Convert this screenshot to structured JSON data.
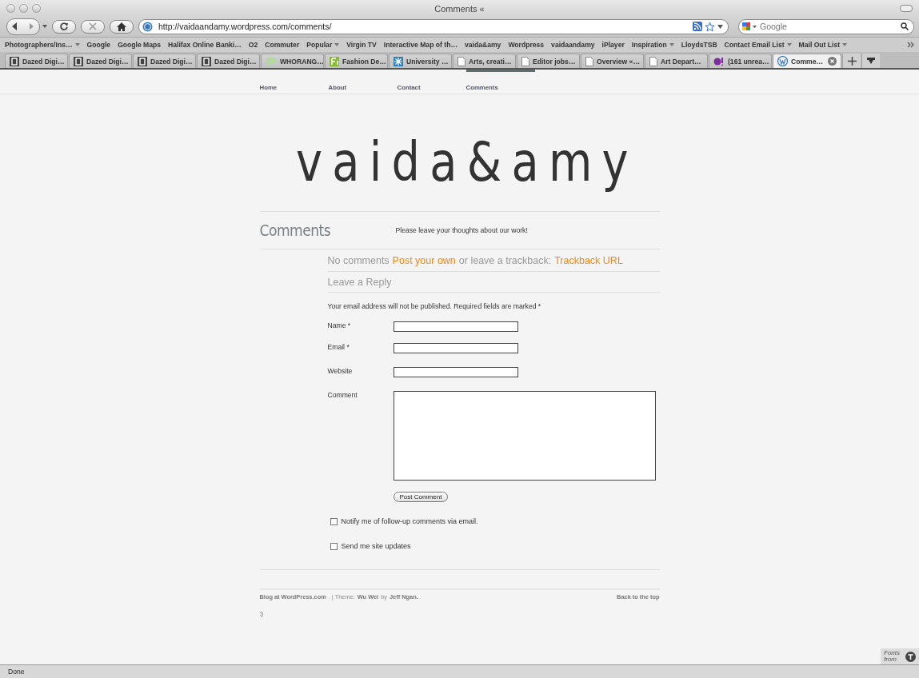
{
  "window": {
    "title": "Comments «"
  },
  "toolbar": {
    "url": "http://vaidaandamy.wordpress.com/comments/",
    "search_placeholder": "Google"
  },
  "bookmarks": [
    {
      "label": "Photographers/Ins…",
      "menu": true
    },
    {
      "label": "Google",
      "menu": false
    },
    {
      "label": "Google Maps",
      "menu": false
    },
    {
      "label": "Halifax Online Banki…",
      "menu": false
    },
    {
      "label": "O2",
      "menu": false
    },
    {
      "label": "Commuter",
      "menu": false
    },
    {
      "label": "Popular",
      "menu": true
    },
    {
      "label": "Virgin TV",
      "menu": false
    },
    {
      "label": "Interactive Map of th…",
      "menu": false
    },
    {
      "label": "vaida&amy",
      "menu": false
    },
    {
      "label": "Wordpress",
      "menu": false
    },
    {
      "label": "vaidaandamy",
      "menu": false
    },
    {
      "label": "iPlayer",
      "menu": false
    },
    {
      "label": "Inspiration",
      "menu": true
    },
    {
      "label": "LloydsTSB",
      "menu": false
    },
    {
      "label": "Contact Email List",
      "menu": true
    },
    {
      "label": "Mail Out List",
      "menu": true
    }
  ],
  "tabs": [
    {
      "label": "Dazed Digi…",
      "kind": "d",
      "selected": false
    },
    {
      "label": "Dazed Digi…",
      "kind": "d",
      "selected": false
    },
    {
      "label": "Dazed Digi…",
      "kind": "d",
      "selected": false
    },
    {
      "label": "Dazed Digi…",
      "kind": "d",
      "selected": false
    },
    {
      "label": "WHORANG…",
      "kind": "bubble",
      "selected": false
    },
    {
      "label": "Fashion De…",
      "kind": "fi",
      "selected": false
    },
    {
      "label": "University …",
      "kind": "star",
      "selected": false
    },
    {
      "label": "Arts, creati…",
      "kind": "page",
      "selected": false
    },
    {
      "label": "Editor jobs…",
      "kind": "page",
      "selected": false
    },
    {
      "label": "Overview «…",
      "kind": "page",
      "selected": false
    },
    {
      "label": "Art Depart…",
      "kind": "page",
      "selected": false
    },
    {
      "label": "(161 unrea…",
      "kind": "yahoo",
      "selected": false
    },
    {
      "label": "Comme…",
      "kind": "wp",
      "selected": true
    }
  ],
  "nav": [
    {
      "label": "Home",
      "selected": false
    },
    {
      "label": "About",
      "selected": false
    },
    {
      "label": "Contact",
      "selected": false
    },
    {
      "label": "Comments",
      "selected": true
    }
  ],
  "logo": "vaida&amy",
  "page": {
    "title": "Comments",
    "description": "Please leave your thoughts about our work!"
  },
  "comments_line": {
    "count": "No comments",
    "post_link": "Post your own",
    "middle": "or leave a trackback:",
    "trackback_link": "Trackback URL"
  },
  "reply": {
    "title": "Leave a Reply",
    "note": "Your email address will not be published. Required fields are marked *",
    "fields": [
      {
        "label": "Name *",
        "kind": "text"
      },
      {
        "label": "Email *",
        "kind": "text"
      },
      {
        "label": "Website",
        "kind": "text"
      },
      {
        "label": "Comment",
        "kind": "textarea"
      }
    ],
    "submit": "Post Comment",
    "options": [
      {
        "label": "Notify me of follow-up comments via email.",
        "checked": false
      },
      {
        "label": "Send me site updates",
        "checked": false
      }
    ]
  },
  "footer": {
    "blog": "Blog at WordPress.com",
    "sep": ". | Theme:",
    "theme": "Wu Wei",
    "by": "by",
    "author": "Jeff Ngan",
    "end": ".",
    "top": "Back to the top"
  },
  "smiley": ":)",
  "fonts_badge": "Fonts from",
  "status_bar": "Done"
}
